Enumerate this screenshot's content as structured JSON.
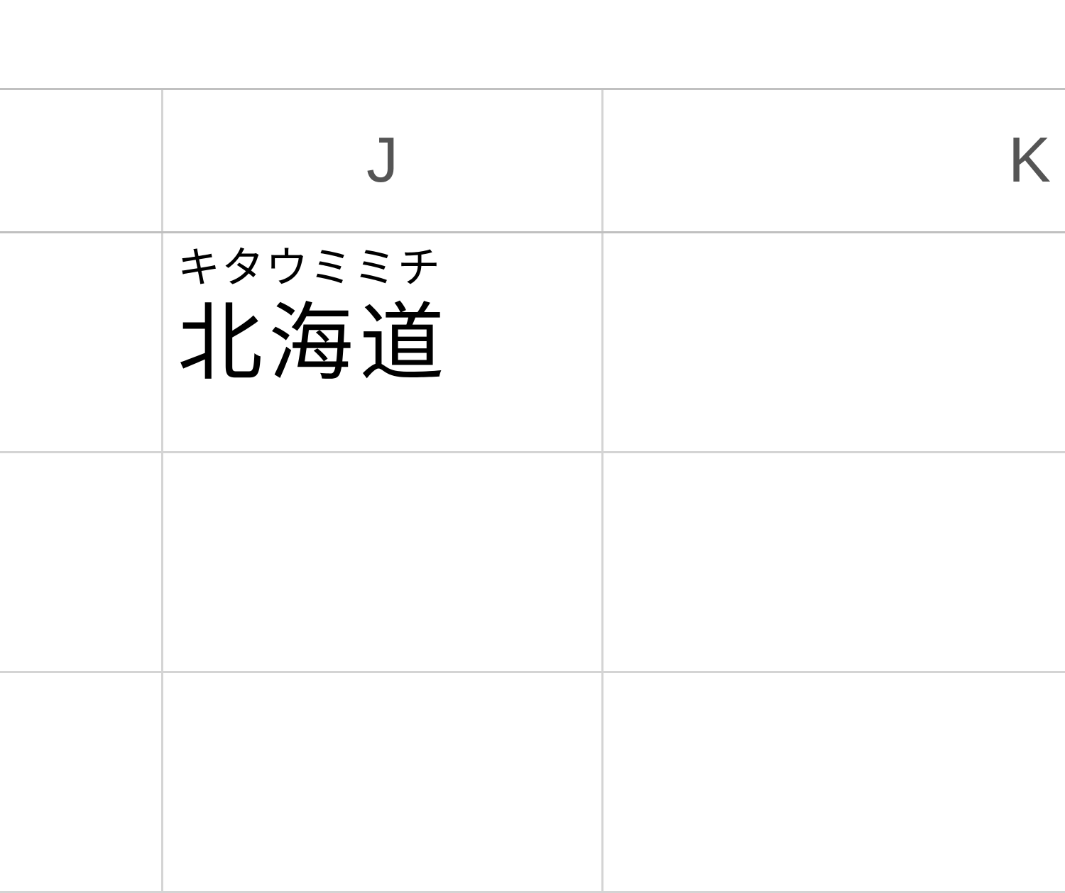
{
  "columns": {
    "j": "J",
    "k": "K"
  },
  "cells": {
    "j1": {
      "phonetic": "キタウミミチ",
      "main": "北海道"
    }
  }
}
